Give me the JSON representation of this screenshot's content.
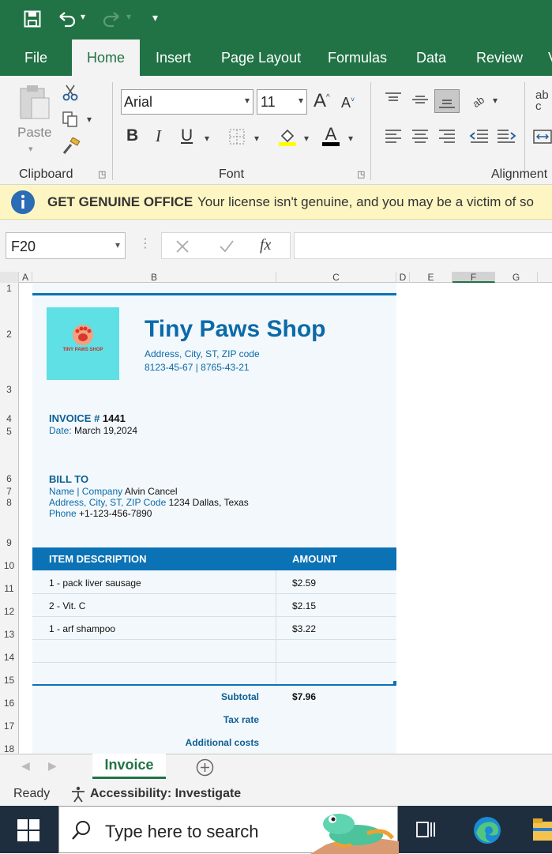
{
  "colors": {
    "excel_green": "#217346",
    "accent_blue": "#0a6aa8",
    "table_header": "#0b72b5",
    "logo_bg": "#5ee0e5"
  },
  "ribbon_tabs": [
    {
      "label": "File",
      "active": false
    },
    {
      "label": "Home",
      "active": true
    },
    {
      "label": "Insert",
      "active": false
    },
    {
      "label": "Page Layout",
      "active": false
    },
    {
      "label": "Formulas",
      "active": false
    },
    {
      "label": "Data",
      "active": false
    },
    {
      "label": "Review",
      "active": false
    },
    {
      "label": "V",
      "active": false
    }
  ],
  "ribbon": {
    "clipboard": {
      "paste_label": "Paste",
      "group_label": "Clipboard"
    },
    "font": {
      "font_name": "Arial",
      "font_size": "11",
      "group_label": "Font",
      "bold": "B",
      "italic": "I",
      "underline": "U"
    },
    "alignment": {
      "group_label": "Alignment",
      "wrap_glyph": "ab"
    }
  },
  "message_bar": {
    "title": "GET GENUINE OFFICE",
    "text": "Your license isn't genuine, and you may be a victim of so"
  },
  "formula_bar": {
    "name_box": "F20",
    "fx": "fx",
    "value": ""
  },
  "columns": [
    "A",
    "B",
    "C",
    "D",
    "E",
    "F",
    "G"
  ],
  "rows": [
    "1",
    "2",
    "3",
    "4",
    "5",
    "6",
    "7",
    "8",
    "9",
    "10",
    "11",
    "12",
    "13",
    "14",
    "15",
    "16",
    "17",
    "18"
  ],
  "invoice": {
    "logo_text": "TINY PAWS SHOP",
    "shop_name": "Tiny Paws Shop",
    "address": "Address, City, ST, ZIP code",
    "phones": "8123-45-67 | 8765-43-21",
    "invoice_label": "INVOICE #",
    "invoice_number": "1441",
    "date_label": "Date:",
    "date_value": "March 19,2024",
    "bill_to": "BILL TO",
    "name_label": "Name | Company",
    "name_value": "Alvin Cancel",
    "addr_label": "Address, City, ST, ZIP Code",
    "addr_value": "1234 Dallas, Texas",
    "phone_label": "Phone",
    "phone_value": "+1-123-456-7890",
    "col_desc": "ITEM DESCRIPTION",
    "col_amount": "AMOUNT",
    "items": [
      {
        "desc": "1 - pack liver sausage",
        "amount": "$2.59"
      },
      {
        "desc": "2 - Vit. C",
        "amount": "$2.15"
      },
      {
        "desc": "1 - arf shampoo",
        "amount": "$3.22"
      }
    ],
    "subtotal_label": "Subtotal",
    "subtotal_value": "$7.96",
    "tax_label": "Tax rate",
    "additional_label": "Additional costs"
  },
  "sheet_tabs": {
    "active": "Invoice"
  },
  "status_bar": {
    "ready": "Ready",
    "accessibility": "Accessibility: Investigate"
  },
  "taskbar": {
    "search_placeholder": "Type here to search"
  }
}
